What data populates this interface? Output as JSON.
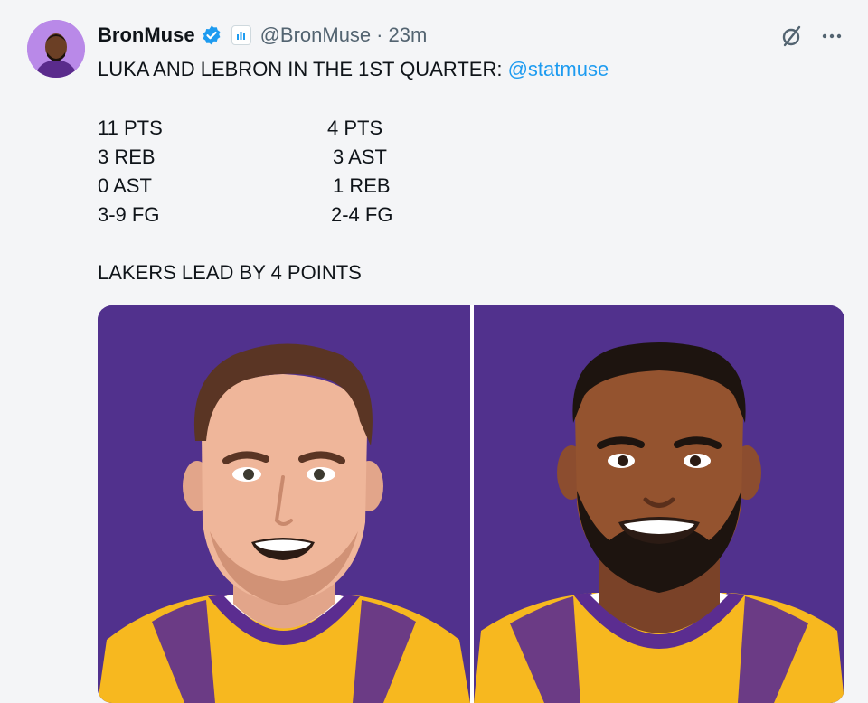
{
  "tweet": {
    "display_name": "BronMuse",
    "handle": "@BronMuse",
    "separator": "·",
    "time": "23m",
    "headline": "LUKA AND LEBRON IN THE 1ST QUARTER:",
    "mention": "@statmuse",
    "luka_stats": [
      "11 PTS",
      "3 REB",
      "0 AST",
      "3-9 FG"
    ],
    "lebron_stats": [
      "4 PTS",
      "3 AST",
      "1 REB",
      "2-4 FG"
    ],
    "lead": "LAKERS LEAD BY 4 POINTS"
  },
  "icons": {
    "verified": "verified-badge-icon",
    "affiliate": "statmuse-affiliate-icon",
    "grok": "grok-icon",
    "more": "more-options-icon"
  },
  "colors": {
    "background": "#f4f5f7",
    "mention": "#1d9bf0",
    "verified": "#1d9bf0",
    "panel_purple": "#51318d",
    "jersey_gold": "#f7b81f"
  }
}
